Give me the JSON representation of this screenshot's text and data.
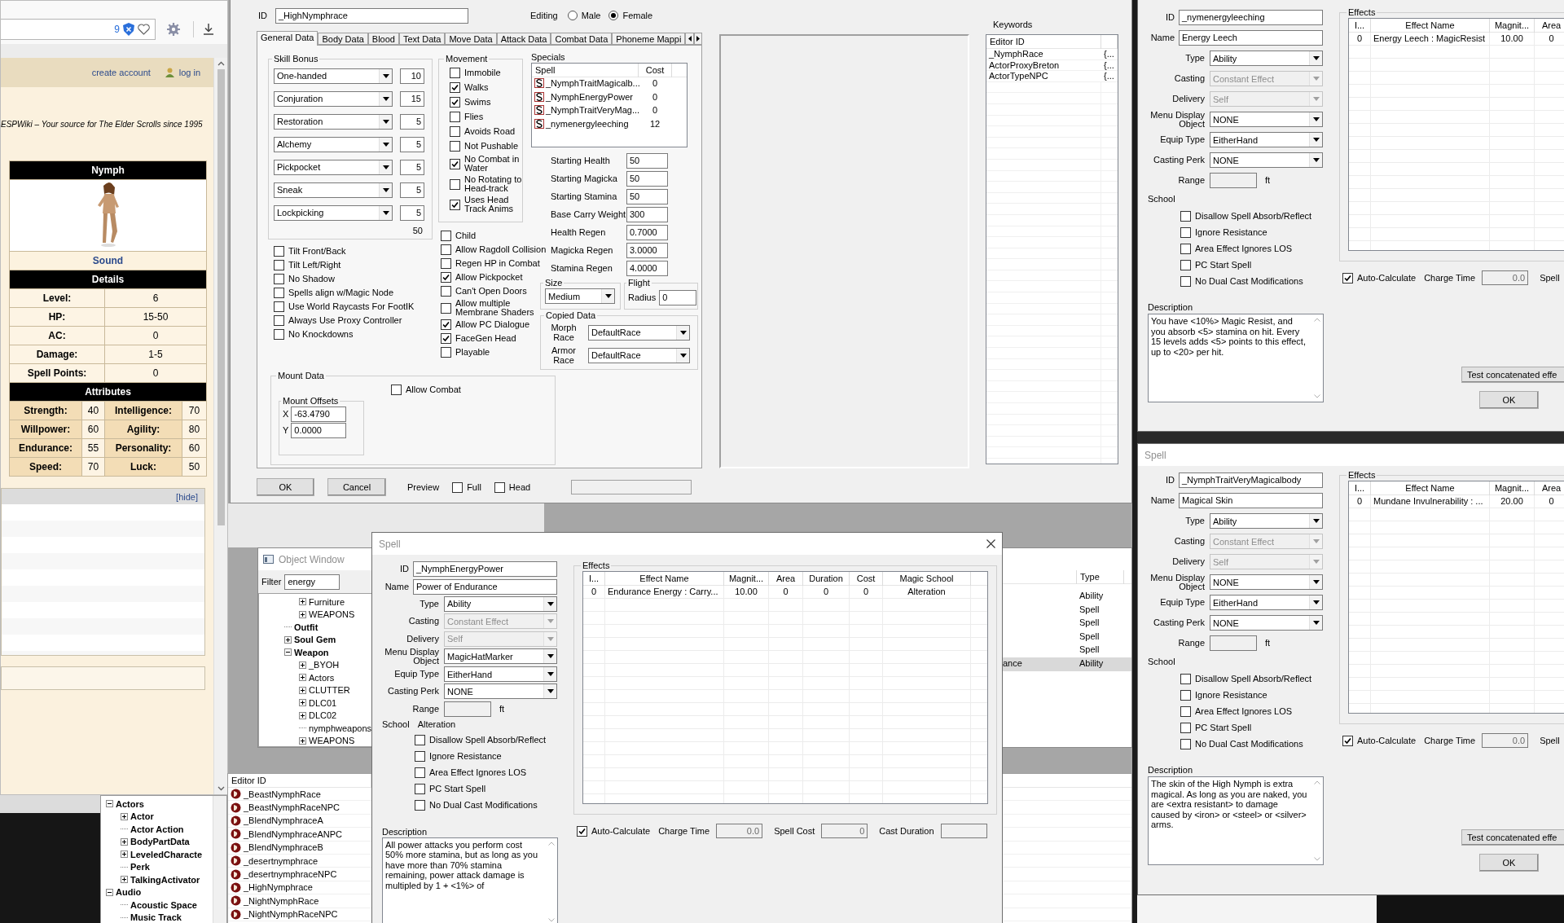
{
  "browser": {
    "badge": "9",
    "links": [
      "create account",
      "log in"
    ],
    "tagline": "ESPWiki – Your source for The Elder Scrolls since 1995",
    "infobox": {
      "title": "Nymph",
      "caption": "Sound",
      "details_title": "Details",
      "details": [
        {
          "label": "Level:",
          "value": "6"
        },
        {
          "label": "HP:",
          "value": "15-50"
        },
        {
          "label": "AC:",
          "value": "0"
        },
        {
          "label": "Damage:",
          "value": "1-5"
        },
        {
          "label": "Spell Points:",
          "value": "0"
        }
      ],
      "attributes_title": "Attributes",
      "attributes": [
        {
          "cells": [
            {
              "label": "Strength:",
              "value": "40"
            },
            {
              "label": "Intelligence:",
              "value": "70"
            }
          ]
        },
        {
          "cells": [
            {
              "label": "Willpower:",
              "value": "60"
            },
            {
              "label": "Agility:",
              "value": "80"
            }
          ]
        },
        {
          "cells": [
            {
              "label": "Endurance:",
              "value": "55"
            },
            {
              "label": "Personality:",
              "value": "60"
            }
          ]
        },
        {
          "cells": [
            {
              "label": "Speed:",
              "value": "70"
            },
            {
              "label": "Luck:",
              "value": "50"
            }
          ]
        }
      ]
    },
    "navbox": {
      "toggle": "[hide]"
    }
  },
  "category_tree": [
    {
      "label": "Actors",
      "kind": "folder",
      "expanded": true,
      "children": [
        {
          "label": "Actor",
          "kind": "folder",
          "expanded": false
        },
        {
          "label": "Actor Action",
          "kind": "leaf"
        },
        {
          "label": "BodyPartData",
          "kind": "folder",
          "expanded": false
        },
        {
          "label": "LeveledCharacte",
          "kind": "folder",
          "expanded": false
        },
        {
          "label": "Perk",
          "kind": "leaf"
        },
        {
          "label": "TalkingActivator",
          "kind": "folder",
          "expanded": false
        }
      ]
    },
    {
      "label": "Audio",
      "kind": "folder",
      "expanded": true,
      "children": [
        {
          "label": "Acoustic Space",
          "kind": "leaf"
        },
        {
          "label": "Music Track",
          "kind": "leaf"
        }
      ]
    }
  ],
  "race_dialog": {
    "id_label": "ID",
    "id": "_HighNymphrace",
    "editing_label": "Editing",
    "genders": [
      {
        "label": "Male",
        "selected": false
      },
      {
        "label": "Female",
        "selected": true
      }
    ],
    "tabs": [
      {
        "label": "General Data",
        "selected": true
      },
      {
        "label": "Body Data",
        "selected": false
      },
      {
        "label": "Blood",
        "selected": false
      },
      {
        "label": "Text Data",
        "selected": false
      },
      {
        "label": "Move Data",
        "selected": false
      },
      {
        "label": "Attack Data",
        "selected": false
      },
      {
        "label": "Combat Data",
        "selected": false
      },
      {
        "label": "Phoneme Mappi",
        "selected": false
      }
    ],
    "skill_bonus": {
      "title": "Skill Bonus",
      "rows": [
        {
          "skill": "One-handed",
          "value": "10"
        },
        {
          "skill": "Conjuration",
          "value": "15"
        },
        {
          "skill": "Restoration",
          "value": "5"
        },
        {
          "skill": "Alchemy",
          "value": "5"
        },
        {
          "skill": "Pickpocket",
          "value": "5"
        },
        {
          "skill": "Sneak",
          "value": "5"
        },
        {
          "skill": "Lockpicking",
          "value": "5"
        }
      ],
      "total": "50"
    },
    "movement": {
      "title": "Movement",
      "items": [
        {
          "label": "Immobile",
          "checked": false
        },
        {
          "label": "Walks",
          "checked": true
        },
        {
          "label": "Swims",
          "checked": true
        },
        {
          "label": "Flies",
          "checked": false
        },
        {
          "label": "Avoids Road",
          "checked": false
        },
        {
          "label": "Not Pushable",
          "checked": false
        },
        {
          "label": "No Combat in Water",
          "checked": true
        },
        {
          "label": "No Rotating to Head-track",
          "checked": false
        },
        {
          "label": "Uses Head Track Anims",
          "checked": true
        }
      ]
    },
    "flags_left": [
      {
        "label": "Tilt Front/Back",
        "checked": false
      },
      {
        "label": "Tilt Left/Right",
        "checked": false
      },
      {
        "label": "No Shadow",
        "checked": false
      },
      {
        "label": "Spells align w/Magic Node",
        "checked": false
      },
      {
        "label": "Use World Raycasts For FootIK",
        "checked": false
      },
      {
        "label": "Always Use Proxy Controller",
        "checked": false
      },
      {
        "label": "No Knockdowns",
        "checked": false
      }
    ],
    "flags_middle": [
      {
        "label": "Child",
        "checked": false
      },
      {
        "label": "Allow Ragdoll Collision",
        "checked": false
      },
      {
        "label": "Regen HP in Combat",
        "checked": false
      },
      {
        "label": "Allow Pickpocket",
        "checked": true
      },
      {
        "label": "Can't Open Doors",
        "checked": false
      },
      {
        "label": "Allow multiple Membrane Shaders",
        "checked": false
      },
      {
        "label": "Allow PC Dialogue",
        "checked": true
      },
      {
        "label": "FaceGen Head",
        "checked": true
      },
      {
        "label": "Playable",
        "checked": false
      }
    ],
    "specials": {
      "title": "Specials",
      "columns": [
        "Spell",
        "Cost"
      ],
      "rows": [
        {
          "spell": "_NymphTraitMagicalb...",
          "cost": "0"
        },
        {
          "spell": "_NymphEnergyPower",
          "cost": "0"
        },
        {
          "spell": "_NymphTraitVeryMag...",
          "cost": "0"
        },
        {
          "spell": "_nymenergyleeching",
          "cost": "12"
        }
      ]
    },
    "stats": [
      {
        "label": "Starting Health",
        "value": "50"
      },
      {
        "label": "Starting Magicka",
        "value": "50"
      },
      {
        "label": "Starting Stamina",
        "value": "50"
      },
      {
        "label": "Base Carry Weight",
        "value": "300"
      },
      {
        "label": "Health Regen",
        "value": "0.7000"
      },
      {
        "label": "Magicka Regen",
        "value": "3.0000"
      },
      {
        "label": "Stamina Regen",
        "value": "4.0000"
      }
    ],
    "size": {
      "title": "Size",
      "value": "Medium"
    },
    "flight": {
      "title": "Flight",
      "label": "Radius",
      "value": "0"
    },
    "copied_data": {
      "title": "Copied Data",
      "rows": [
        {
          "label": "Morph Race",
          "value": "DefaultRace"
        },
        {
          "label": "Armor Race",
          "value": "DefaultRace"
        }
      ]
    },
    "mount_data": {
      "title": "Mount Data",
      "allow_combat": {
        "label": "Allow Combat",
        "checked": false
      },
      "offsets_title": "Mount Offsets",
      "offsets": [
        {
          "axis": "X",
          "value": "-63.4790"
        },
        {
          "axis": "Y",
          "value": "0.0000"
        }
      ]
    },
    "buttons": [
      "OK",
      "Cancel"
    ],
    "preview": {
      "label": "Preview",
      "options": [
        {
          "label": "Full",
          "checked": false
        },
        {
          "label": "Head",
          "checked": false
        }
      ]
    },
    "keywords": {
      "title": "Keywords",
      "columns": [
        "Editor ID"
      ],
      "rows": [
        {
          "editor_id": "_NymphRace",
          "column_2": "{..."
        },
        {
          "editor_id": "ActorProxyBreton",
          "column_2": "{..."
        },
        {
          "editor_id": "ActorTypeNPC",
          "column_2": "{..."
        }
      ]
    }
  },
  "object_window": {
    "title": "Object Window",
    "filter_label": "Filter",
    "filter": "energy",
    "tree": {
      "scrolled_children": [
        {
          "label": "Furniture",
          "kind": "folder",
          "expanded": false
        },
        {
          "label": "WEAPONS",
          "kind": "folder",
          "expanded": false
        }
      ],
      "items": [
        {
          "label": "Outfit",
          "kind": "leaf"
        },
        {
          "label": "Soul Gem",
          "kind": "folder",
          "expanded": false
        },
        {
          "label": "Weapon",
          "kind": "folder",
          "expanded": true,
          "children": [
            {
              "label": "_BYOH",
              "kind": "folder",
              "expanded": false
            },
            {
              "label": "Actors",
              "kind": "folder",
              "expanded": false
            },
            {
              "label": "CLUTTER",
              "kind": "folder",
              "expanded": false
            },
            {
              "label": "DLC01",
              "kind": "folder",
              "expanded": false
            },
            {
              "label": "DLC02",
              "kind": "folder",
              "expanded": false
            },
            {
              "label": "nymphweapons",
              "kind": "leaf"
            },
            {
              "label": "WEAPONS",
              "kind": "folder",
              "expanded": false
            }
          ]
        }
      ]
    },
    "list": {
      "columns": [
        "Type"
      ],
      "rows": [
        {
          "type": "Ability",
          "selected": false
        },
        {
          "type": "Spell",
          "selected": false
        },
        {
          "type": "Spell",
          "selected": false
        },
        {
          "type": "Spell",
          "selected": false
        },
        {
          "type": "Spell",
          "selected": false
        },
        {
          "column_1": "ance",
          "type": "Ability",
          "selected": true
        }
      ]
    }
  },
  "editor_list": {
    "column": "Editor ID",
    "rows": [
      "_BeastNymphRace",
      "_BeastNymphRaceNPC",
      "_BlendNymphraceA",
      "_BlendNymphraceANPC",
      "_BlendNymphraceB",
      "_desertnymphrace",
      "_desertnymphraceNPC",
      "_HighNymphrace",
      "_NightNymphRace",
      "_NightNymphRaceNPC"
    ]
  },
  "spell_dialogs": [
    {
      "fields": [
        {
          "label": "ID",
          "value": "_nymenergyleeching",
          "kind": "text"
        },
        {
          "label": "Name",
          "value": "Energy Leech",
          "kind": "text"
        },
        {
          "label": "Type",
          "value": "Ability",
          "kind": "select",
          "disabled": false
        },
        {
          "label": "Casting",
          "value": "Constant Effect",
          "kind": "select",
          "disabled": true
        },
        {
          "label": "Delivery",
          "value": "Self",
          "kind": "select",
          "disabled": true
        },
        {
          "label": "Menu Display Object",
          "value": "NONE",
          "kind": "select",
          "disabled": false
        },
        {
          "label": "Equip Type",
          "value": "EitherHand",
          "kind": "select",
          "disabled": false
        },
        {
          "label": "Casting Perk",
          "value": "NONE",
          "kind": "select",
          "disabled": false
        },
        {
          "label": "Range",
          "kind": "range",
          "unit": "ft"
        }
      ],
      "school": {
        "label": "School"
      },
      "flags": [
        {
          "label": "Disallow Spell Absorb/Reflect",
          "checked": false
        },
        {
          "label": "Ignore Resistance",
          "checked": false
        },
        {
          "label": "Area Effect Ignores LOS",
          "checked": false
        },
        {
          "label": "PC Start Spell",
          "checked": false
        },
        {
          "label": "No Dual Cast Modifications",
          "checked": false
        }
      ],
      "description": {
        "label": "Description",
        "text": "You have <10%> Magic Resist, and you absorb <5> stamina on hit. Every 15 levels adds <5> points to this effect, up to <20> per hit."
      },
      "effects": {
        "title": "Effects",
        "columns": [
          "I...",
          "Effect Name",
          "Magnit...",
          "Area"
        ],
        "rows": [
          {
            "cells": [
              "0",
              "Energy Leech : MagicResist",
              "10.00",
              "0"
            ]
          }
        ]
      },
      "auto_calculate": {
        "label": "Auto-Calculate",
        "checked": true
      },
      "costs": [
        {
          "label": "Charge Time",
          "value": "0.0",
          "kind": "field"
        },
        {
          "label": "Spell",
          "kind": "label"
        }
      ],
      "buttons": [
        "Test concatenated effe",
        "OK"
      ]
    },
    {
      "title": "Spell",
      "close_button": true,
      "fields": [
        {
          "label": "ID",
          "value": "_NymphEnergyPower",
          "kind": "text"
        },
        {
          "label": "Name",
          "value": "Power of Endurance",
          "kind": "text"
        },
        {
          "label": "Type",
          "value": "Ability",
          "kind": "select",
          "disabled": false
        },
        {
          "label": "Casting",
          "value": "Constant Effect",
          "kind": "select",
          "disabled": true
        },
        {
          "label": "Delivery",
          "value": "Self",
          "kind": "select",
          "disabled": true
        },
        {
          "label": "Menu Display Object",
          "value": "MagicHatMarker",
          "kind": "select",
          "disabled": false
        },
        {
          "label": "Equip Type",
          "value": "EitherHand",
          "kind": "select",
          "disabled": false
        },
        {
          "label": "Casting Perk",
          "value": "NONE",
          "kind": "select",
          "disabled": false
        },
        {
          "label": "Range",
          "kind": "range",
          "unit": "ft"
        }
      ],
      "school": {
        "label": "School",
        "value": "Alteration"
      },
      "flags": [
        {
          "label": "Disallow Spell Absorb/Reflect",
          "checked": false
        },
        {
          "label": "Ignore Resistance",
          "checked": false
        },
        {
          "label": "Area Effect Ignores LOS",
          "checked": false
        },
        {
          "label": "PC Start Spell",
          "checked": false
        },
        {
          "label": "No Dual Cast Modifications",
          "checked": false
        }
      ],
      "description": {
        "label": "Description",
        "text": "All power attacks you perform cost 50% more stamina, but as long as you have more than 70% stamina remaining, power attack damage is multipled by 1 + <1%> of"
      },
      "effects": {
        "title": "Effects",
        "columns": [
          "I...",
          "Effect Name",
          "Magnit...",
          "Area",
          "Duration",
          "Cost",
          "Magic School"
        ],
        "rows": [
          {
            "cells": [
              "0",
              "Endurance Energy : Carry...",
              "10.00",
              "0",
              "0",
              "0",
              "Alteration"
            ]
          }
        ]
      },
      "auto_calculate": {
        "label": "Auto-Calculate",
        "checked": true
      },
      "costs": [
        {
          "label": "Charge Time",
          "value": "0.0",
          "kind": "field"
        },
        {
          "label": "Spell Cost",
          "value": "0",
          "kind": "field"
        },
        {
          "label": "Cast Duration",
          "kind": "field"
        }
      ]
    },
    {
      "title": "Spell",
      "fields": [
        {
          "label": "ID",
          "value": "_NymphTraitVeryMagicalbody",
          "kind": "text"
        },
        {
          "label": "Name",
          "value": "Magical Skin",
          "kind": "text"
        },
        {
          "label": "Type",
          "value": "Ability",
          "kind": "select",
          "disabled": false
        },
        {
          "label": "Casting",
          "value": "Constant Effect",
          "kind": "select",
          "disabled": true
        },
        {
          "label": "Delivery",
          "value": "Self",
          "kind": "select",
          "disabled": true
        },
        {
          "label": "Menu Display Object",
          "value": "NONE",
          "kind": "select",
          "disabled": false
        },
        {
          "label": "Equip Type",
          "value": "EitherHand",
          "kind": "select",
          "disabled": false
        },
        {
          "label": "Casting Perk",
          "value": "NONE",
          "kind": "select",
          "disabled": false
        },
        {
          "label": "Range",
          "kind": "range",
          "unit": "ft"
        }
      ],
      "school": {
        "label": "School"
      },
      "flags": [
        {
          "label": "Disallow Spell Absorb/Reflect",
          "checked": false
        },
        {
          "label": "Ignore Resistance",
          "checked": false
        },
        {
          "label": "Area Effect Ignores LOS",
          "checked": false
        },
        {
          "label": "PC Start Spell",
          "checked": false
        },
        {
          "label": "No Dual Cast Modifications",
          "checked": false
        }
      ],
      "description": {
        "label": "Description",
        "text": "The skin of the High Nymph is extra magical. As long as you are naked, you are <extra resistant> to damage caused by <iron> or <steel> or <silver> arms."
      },
      "effects": {
        "title": "Effects",
        "columns": [
          "I...",
          "Effect Name",
          "Magnit...",
          "Area"
        ],
        "rows": [
          {
            "cells": [
              "0",
              "Mundane Invulnerability : ...",
              "20.00",
              "0"
            ]
          }
        ]
      },
      "auto_calculate": {
        "label": "Auto-Calculate",
        "checked": true
      },
      "costs": [
        {
          "label": "Charge Time",
          "value": "0.0",
          "kind": "field"
        },
        {
          "label": "Spell",
          "kind": "label"
        }
      ],
      "buttons": [
        "Test concatenated effe",
        "OK"
      ]
    }
  ]
}
